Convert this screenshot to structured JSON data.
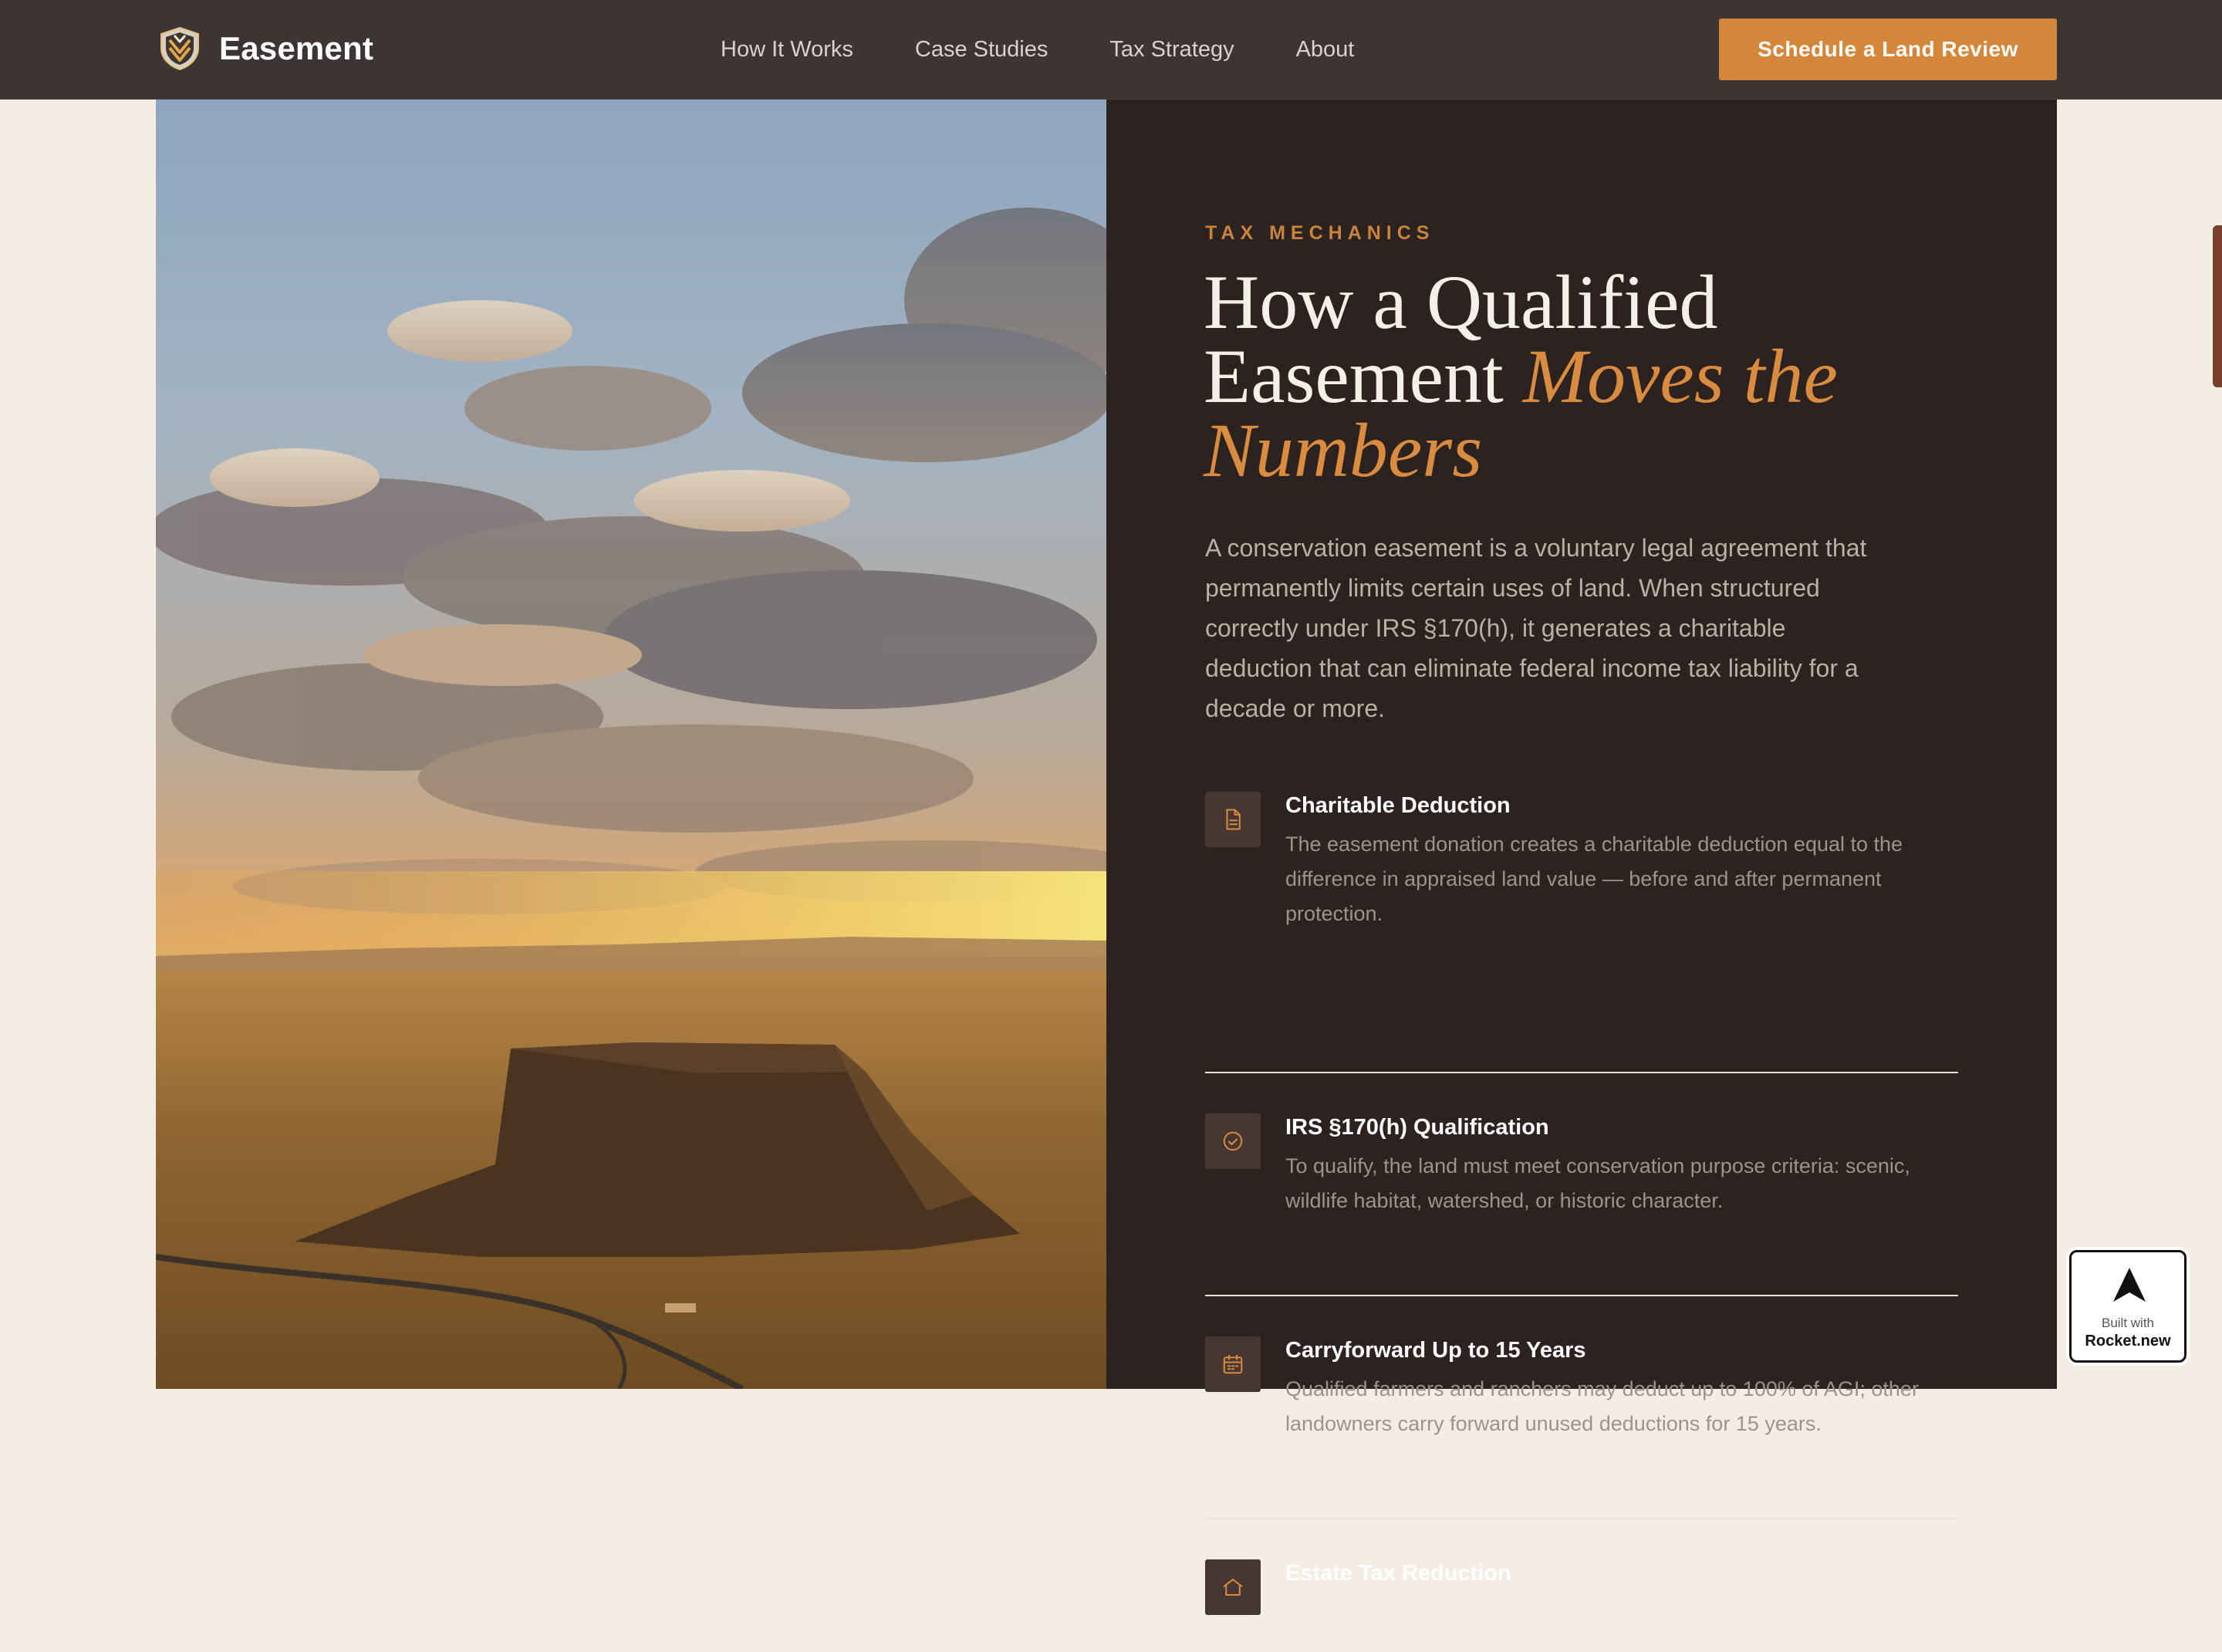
{
  "nav": {
    "brand": "Easement",
    "brand_icon": "shield-crest-icon",
    "links": [
      "How It Works",
      "Case Studies",
      "Tax Strategy",
      "About"
    ],
    "cta": "Schedule a Land Review"
  },
  "section": {
    "eyebrow": "TAX MECHANICS",
    "headline_part1": "How a Qualified Easement ",
    "headline_accent": "Moves the Numbers",
    "lead": "A conservation easement is a voluntary legal agreement that permanently limits certain uses of land. When structured correctly under IRS §170(h), it generates a charitable deduction that can eliminate federal income tax liability for a decade or more.",
    "features": [
      {
        "icon": "document-icon",
        "title": "Charitable Deduction",
        "body": "The easement donation creates a charitable deduction equal to the difference in appraised land value — before and after permanent protection."
      },
      {
        "icon": "check-circle-icon",
        "title": "IRS §170(h) Qualification",
        "body": "To qualify, the land must meet conservation purpose criteria: scenic, wildlife habitat, watershed, or historic character."
      },
      {
        "icon": "calendar-icon",
        "title": "Carryforward Up to 15 Years",
        "body": "Qualified farmers and ranchers may deduct up to 100% of AGI; other landowners carry forward unused deductions for 15 years."
      },
      {
        "icon": "estate-icon",
        "title": "Estate Tax Reduction",
        "body": ""
      }
    ]
  },
  "badge": {
    "line1": "Built with",
    "line2": "Rocket.new",
    "icon": "rocket-icon"
  },
  "colors": {
    "nav_bg": "#3c3533",
    "panel_bg": "#2c2220",
    "accent": "#d4873a",
    "page_bg": "#f4ede4"
  }
}
